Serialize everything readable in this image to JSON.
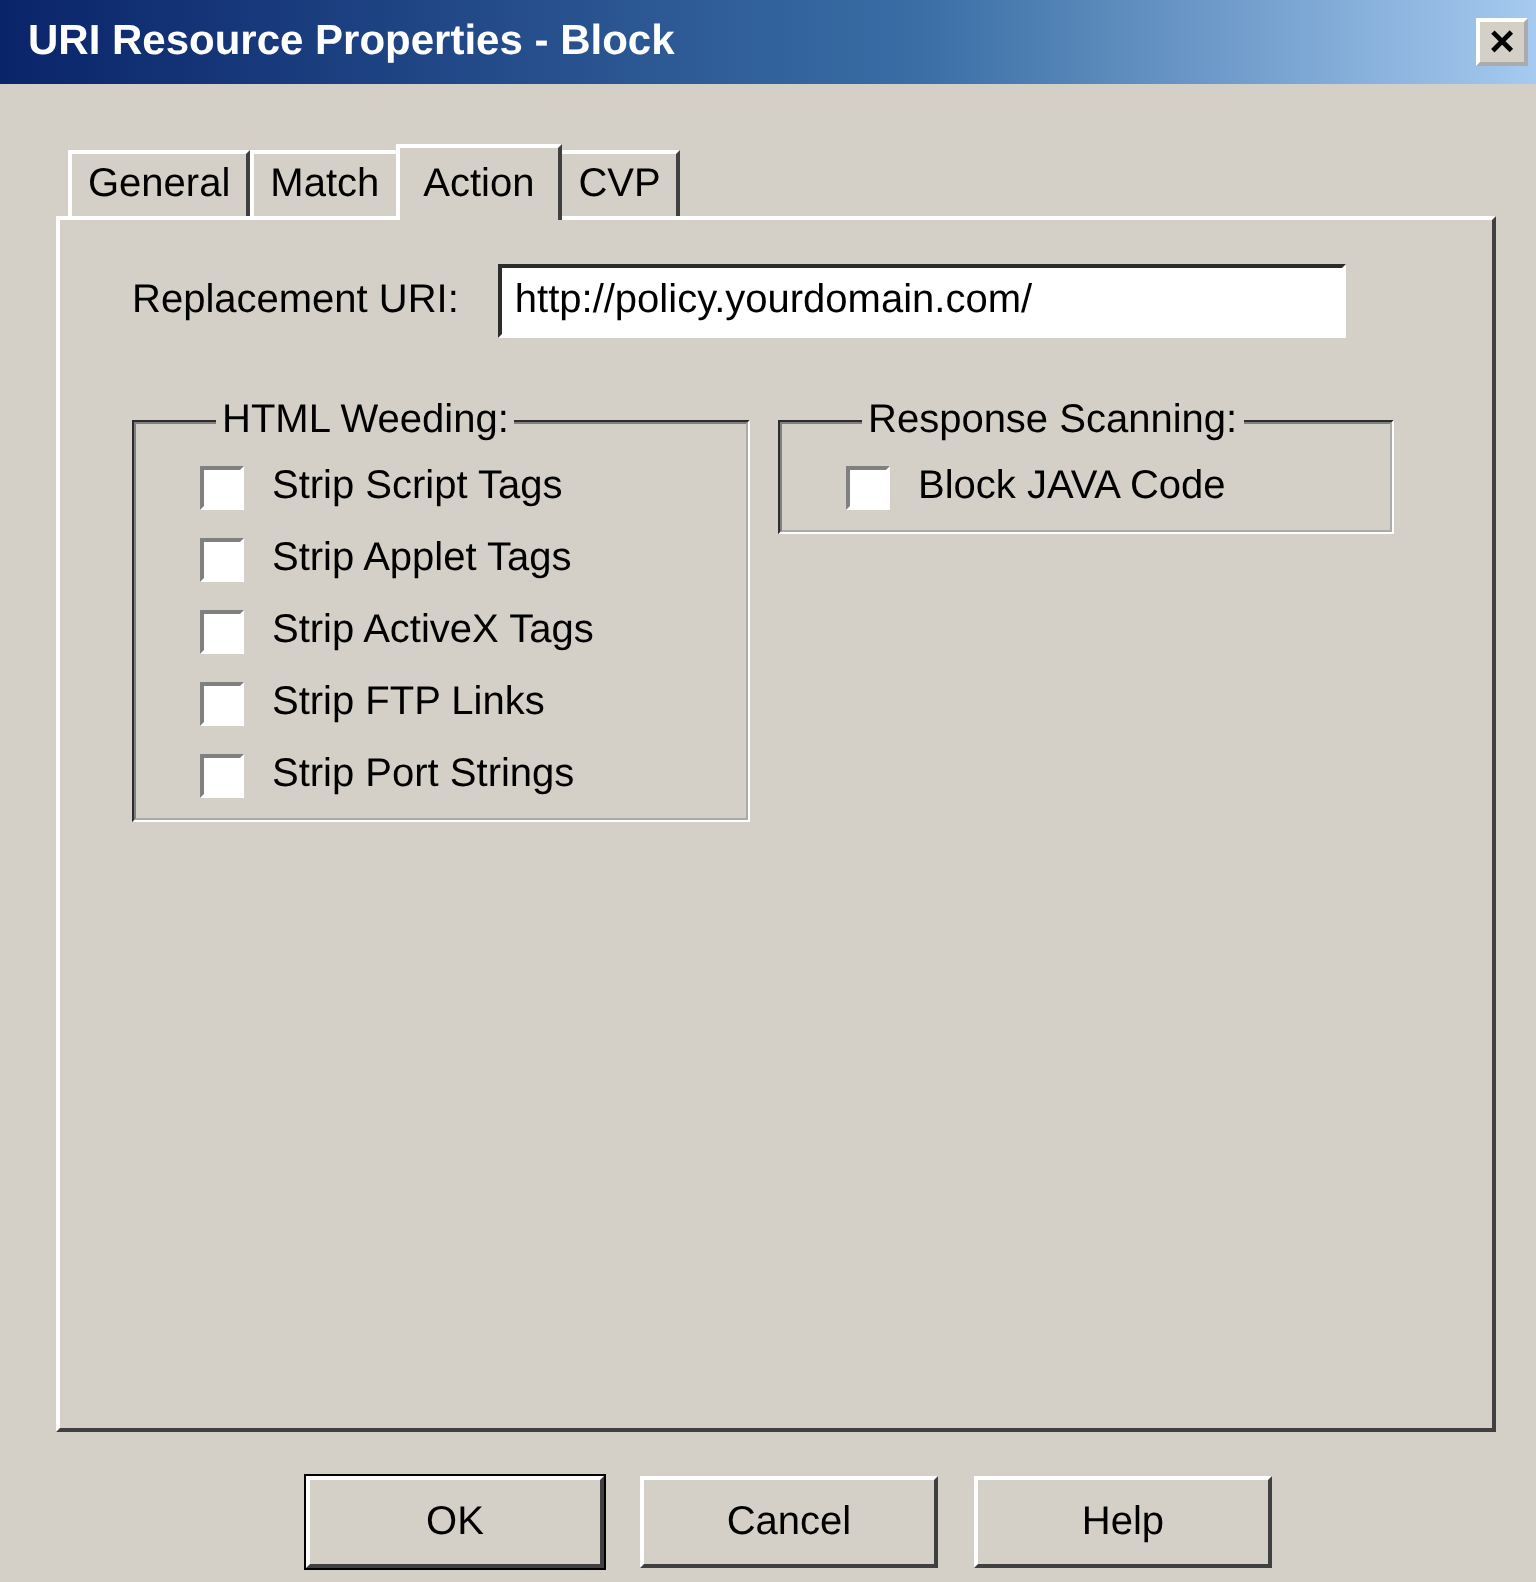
{
  "window": {
    "title": "URI Resource Properties - Block",
    "close": "×"
  },
  "tabs": [
    {
      "label": "General",
      "selected": false
    },
    {
      "label": "Match",
      "selected": false
    },
    {
      "label": "Action",
      "selected": true
    },
    {
      "label": "CVP",
      "selected": false
    }
  ],
  "replacement_uri": {
    "label": "Replacement URI:",
    "value": "http://policy.yourdomain.com/"
  },
  "html_weeding": {
    "title": "HTML Weeding:",
    "options": [
      {
        "label": "Strip Script Tags",
        "checked": false
      },
      {
        "label": "Strip Applet Tags",
        "checked": false
      },
      {
        "label": "Strip ActiveX Tags",
        "checked": false
      },
      {
        "label": "Strip FTP Links",
        "checked": false
      },
      {
        "label": "Strip Port Strings",
        "checked": false
      }
    ]
  },
  "response_scanning": {
    "title": "Response Scanning:",
    "options": [
      {
        "label": "Block JAVA Code",
        "checked": false
      }
    ]
  },
  "buttons": [
    "OK",
    "Cancel",
    "Help"
  ]
}
